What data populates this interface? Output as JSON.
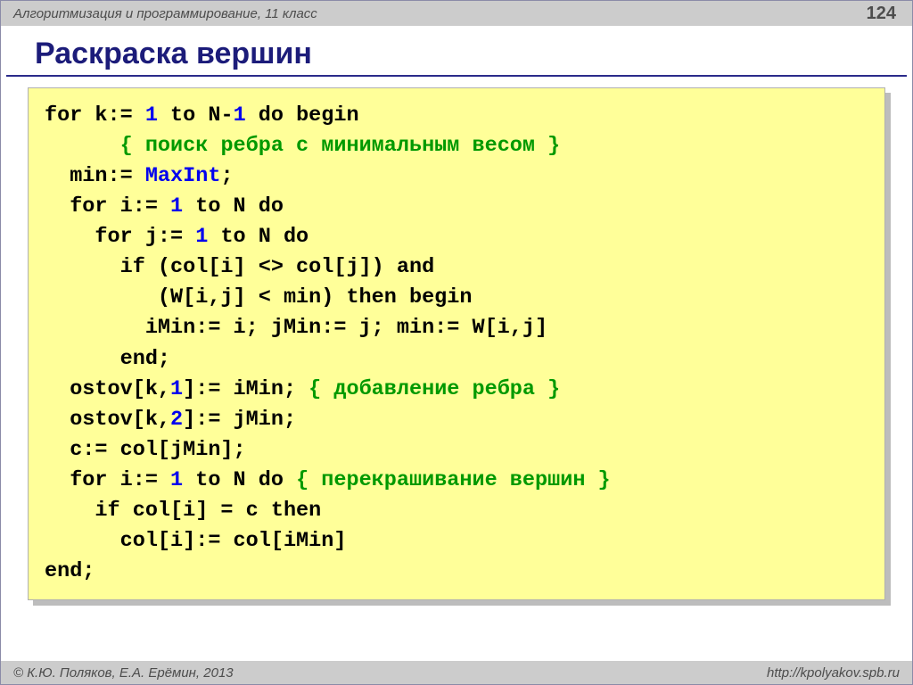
{
  "meta": {
    "subject": "Алгоритмизация и программирование, 11 класс",
    "page": "124",
    "copyright": "© К.Ю. Поляков, Е.А. Ерёмин, 2013",
    "url": "http://kpolyakov.spb.ru"
  },
  "title": "Раскраска вершин",
  "code": {
    "t1": "for k:= ",
    "n1": "1",
    "t2": " to N-",
    "n1b": "1",
    "t3": " do begin",
    "c1": "{ поиск ребра с минимальным весом }",
    "t4": "  min:= ",
    "id1": "MaxInt",
    "t4b": ";",
    "t5": "  for i:= ",
    "n2": "1",
    "t5b": " to N do",
    "t6": "    for j:= ",
    "n3": "1",
    "t6b": " to N do",
    "t7": "      if (col[i] <> col[j]) and",
    "t8": "         (W[i,j] < min) then begin",
    "t9": "        iMin:= i; jMin:= j; min:= W[i,j]",
    "t10": "      end;",
    "t11a": "  ostov[k,",
    "n4": "1",
    "t11b": "]:= iMin; ",
    "c2": "{ добавление ребра }",
    "t12a": "  ostov[k,",
    "n5": "2",
    "t12b": "]:= jMin;",
    "t13": "  c:= col[jMin];",
    "t14a": "  for i:= ",
    "n6": "1",
    "t14b": " to N do ",
    "c3": "{ перекрашивание вершин }",
    "t15": "    if col[i] = c then",
    "t16": "      col[i]:= col[iMin]",
    "t17": "end;"
  }
}
